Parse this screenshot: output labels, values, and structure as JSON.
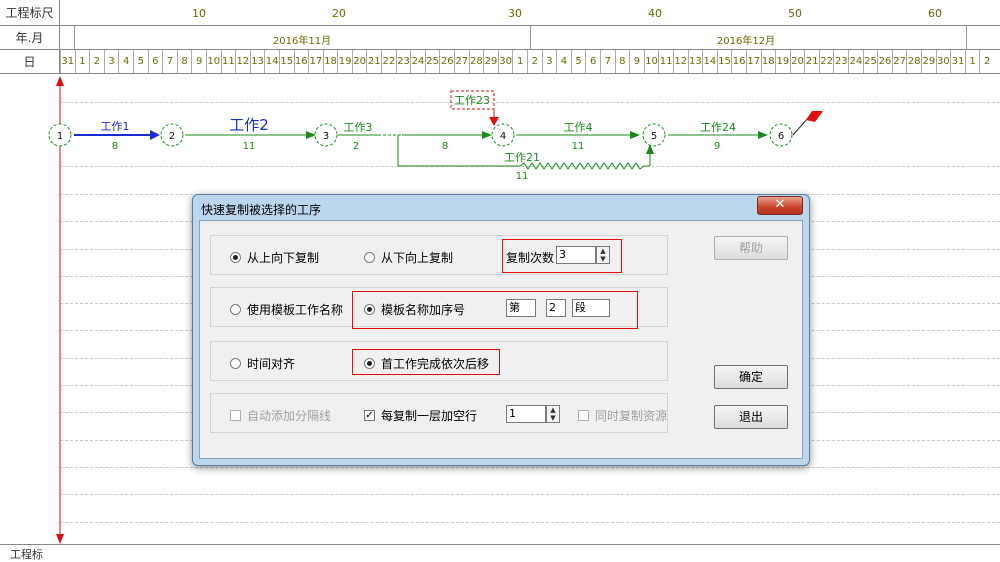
{
  "ruler": {
    "row1_label": "工程标尺",
    "row1_ticks": [
      "10",
      "20",
      "30",
      "40",
      "50",
      "60"
    ],
    "row2_label": "年.月",
    "months": [
      "2016年11月",
      "2016年12月"
    ],
    "row3_label": "日",
    "days": [
      "31",
      "1",
      "2",
      "3",
      "4",
      "5",
      "6",
      "7",
      "8",
      "9",
      "10",
      "11",
      "12",
      "13",
      "14",
      "15",
      "16",
      "17",
      "18",
      "19",
      "20",
      "21",
      "22",
      "23",
      "24",
      "25",
      "26",
      "27",
      "28",
      "29",
      "30",
      "1",
      "2",
      "3",
      "4",
      "5",
      "6",
      "7",
      "8",
      "9",
      "10",
      "11",
      "12",
      "13",
      "14",
      "15",
      "16",
      "17",
      "18",
      "19",
      "20",
      "21",
      "22",
      "23",
      "24",
      "25",
      "26",
      "27",
      "28",
      "29",
      "30",
      "31",
      "1",
      "2"
    ],
    "bottom_label": "工程标"
  },
  "network": {
    "nodes": [
      "1",
      "2",
      "3",
      "4",
      "5",
      "6"
    ],
    "tasks": [
      {
        "name": "工作1",
        "duration": "8"
      },
      {
        "name": "工作2",
        "duration": "11"
      },
      {
        "name": "工作3",
        "duration": "2"
      },
      {
        "name": "",
        "duration": "8"
      },
      {
        "name": "工作4",
        "duration": "11"
      },
      {
        "name": "工作24",
        "duration": "9"
      },
      {
        "name": "工作21",
        "duration": "11"
      }
    ],
    "selected_task": "工作23"
  },
  "dialog": {
    "title": "快速复制被选择的工序",
    "close_glyph": "✕",
    "group1": {
      "opt_top_down": "从上向下复制",
      "opt_bottom_up": "从下向上复制",
      "copy_count_label": "复制次数",
      "copy_count": "3"
    },
    "group2": {
      "opt_template": "使用模板工作名称",
      "opt_template_seq": "模板名称加序号",
      "prefix": "第",
      "seq": "2",
      "suffix": "段"
    },
    "group3": {
      "opt_time_align": "时间对齐",
      "opt_first_shift": "首工作完成依次后移"
    },
    "group4": {
      "auto_divider": "自动添加分隔线",
      "add_blank_row": "每复制一层加空行",
      "blank_rows": "1",
      "copy_resources": "同时复制资源"
    },
    "buttons": {
      "help": "帮助",
      "ok": "确定",
      "exit": "退出"
    }
  },
  "colors": {
    "accent_red": "#e01010",
    "ruler_text": "#6b6b00",
    "arrow_green": "#1a8a1a",
    "arrow_blue": "#1a2ad0"
  }
}
